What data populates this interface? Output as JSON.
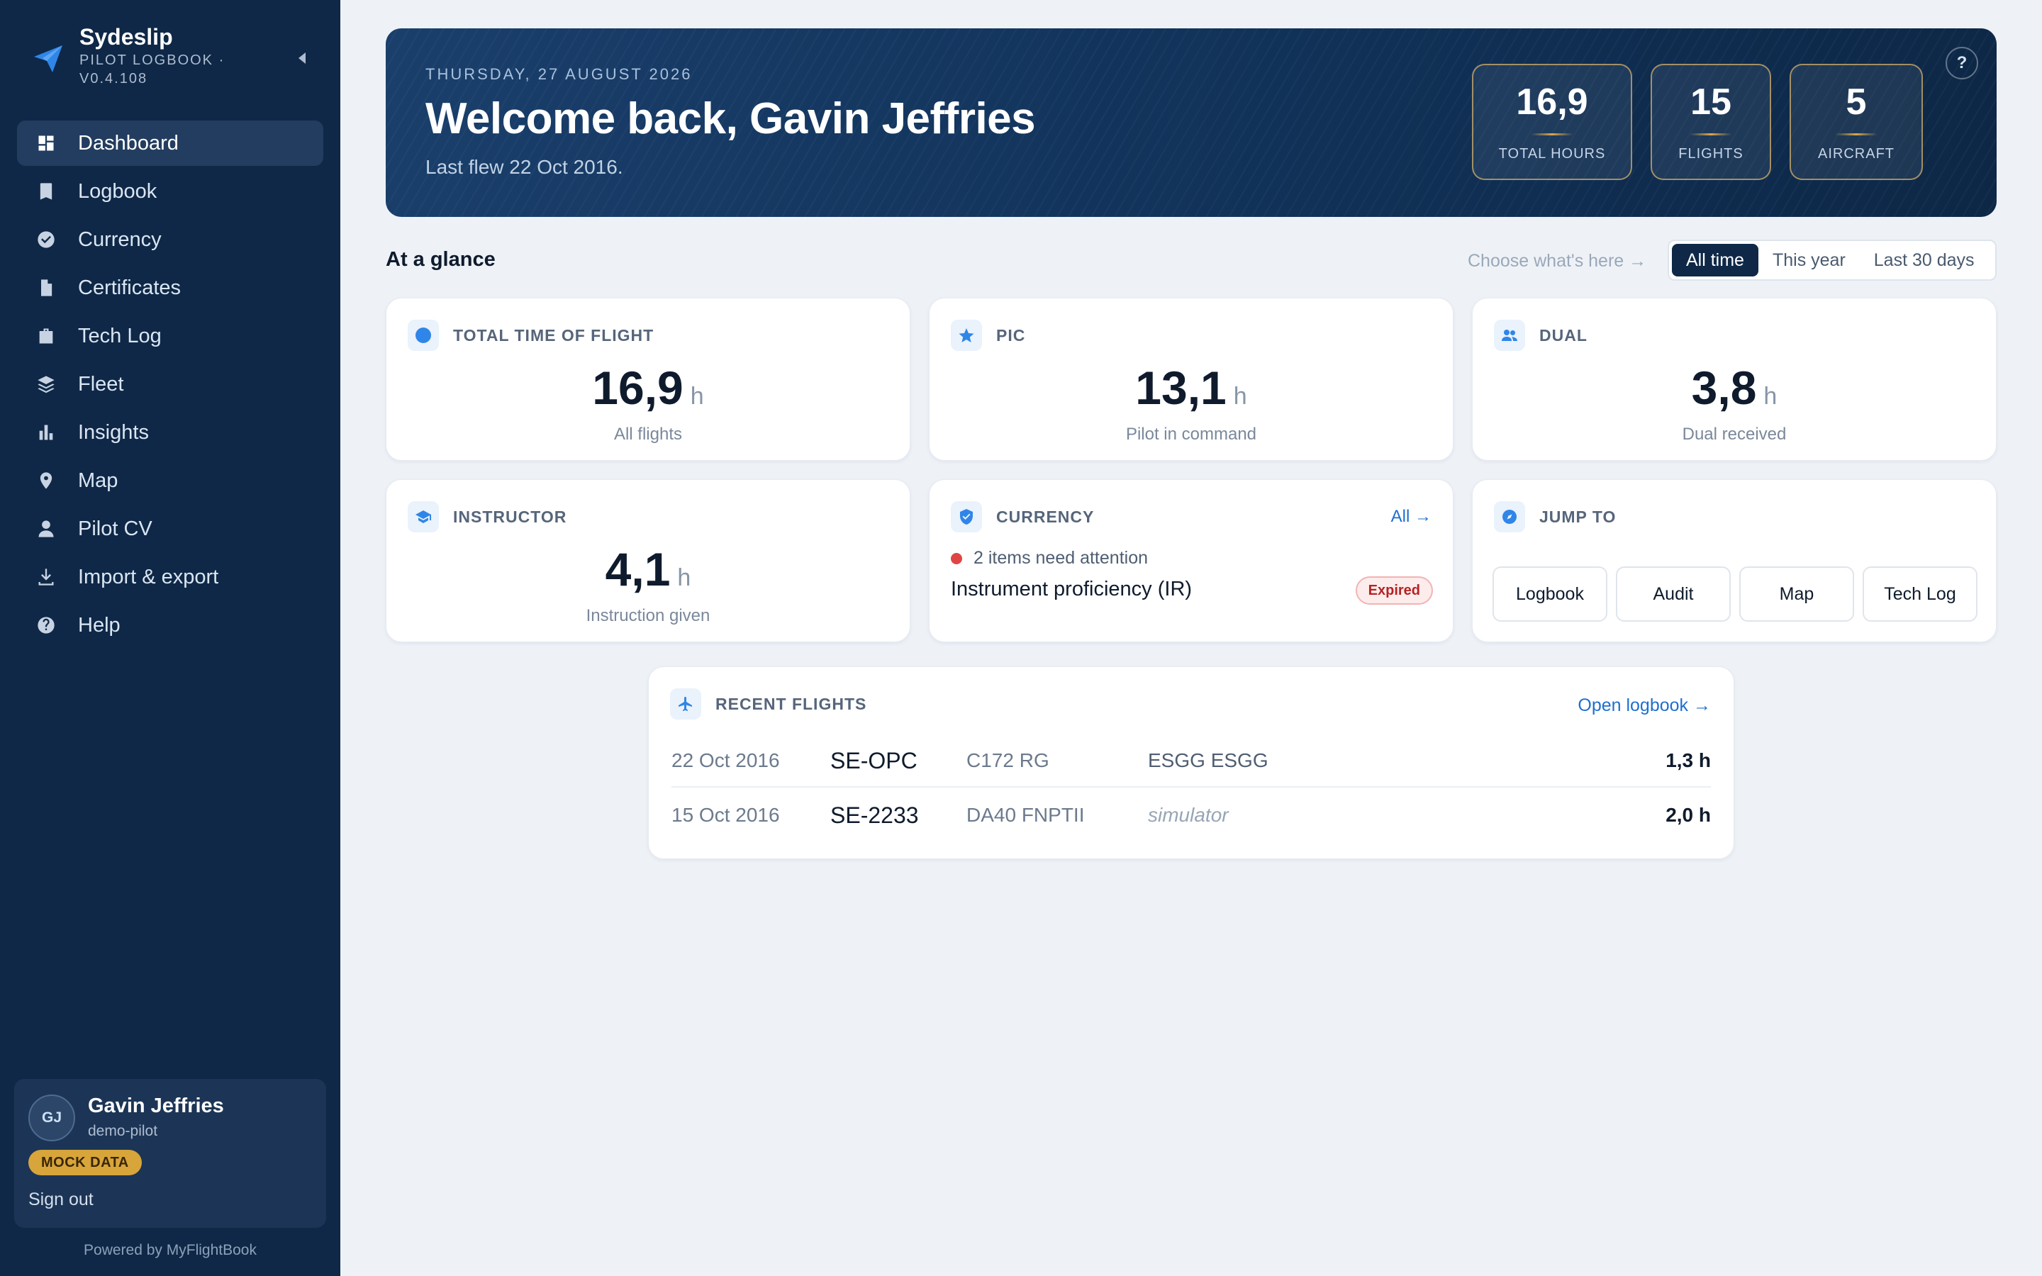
{
  "app": {
    "name": "Sydeslip",
    "subtitle": "PILOT LOGBOOK · V0.4.108",
    "accent": "#2f86e8",
    "sidebar_bg": "#0f2847"
  },
  "nav": [
    {
      "label": "Dashboard",
      "icon": "dashboard-icon",
      "active": true
    },
    {
      "label": "Logbook",
      "icon": "book-icon"
    },
    {
      "label": "Currency",
      "icon": "check-circle-icon"
    },
    {
      "label": "Certificates",
      "icon": "document-icon"
    },
    {
      "label": "Tech Log",
      "icon": "briefcase-icon"
    },
    {
      "label": "Fleet",
      "icon": "layers-icon"
    },
    {
      "label": "Insights",
      "icon": "bar-chart-icon"
    },
    {
      "label": "Map",
      "icon": "map-pin-icon"
    },
    {
      "label": "Pilot CV",
      "icon": "person-icon"
    },
    {
      "label": "Import & export",
      "icon": "download-icon"
    },
    {
      "label": "Help",
      "icon": "help-circle-icon"
    }
  ],
  "user": {
    "initials": "GJ",
    "name": "Gavin Jeffries",
    "handle": "demo-pilot",
    "badge": "MOCK DATA",
    "sign_out": "Sign out"
  },
  "footer": {
    "powered": "Powered by MyFlightBook"
  },
  "hero": {
    "date": "THURSDAY, 27 AUGUST 2026",
    "title": "Welcome back, Gavin Jeffries",
    "subtitle": "Last flew 22 Oct 2016.",
    "help": "?",
    "stats": [
      {
        "value": "16,9",
        "label": "TOTAL HOURS"
      },
      {
        "value": "15",
        "label": "FLIGHTS"
      },
      {
        "value": "5",
        "label": "AIRCRAFT"
      }
    ]
  },
  "glance": {
    "title": "At a glance",
    "choose": "Choose what's here →",
    "ranges": [
      "All time",
      "This year",
      "Last 30 days"
    ],
    "active_range": "All time"
  },
  "cards": {
    "total": {
      "label": "TOTAL TIME OF FLIGHT",
      "value": "16,9",
      "unit": "h",
      "caption": "All flights"
    },
    "pic": {
      "label": "PIC",
      "value": "13,1",
      "unit": "h",
      "caption": "Pilot in command"
    },
    "dual": {
      "label": "DUAL",
      "value": "3,8",
      "unit": "h",
      "caption": "Dual received"
    },
    "instructor": {
      "label": "INSTRUCTOR",
      "value": "4,1",
      "unit": "h",
      "caption": "Instruction given"
    },
    "currency": {
      "label": "CURRENCY",
      "link": "All →",
      "alert": "2 items need attention",
      "item": "Instrument proficiency (IR)",
      "status": "Expired"
    },
    "jump": {
      "label": "JUMP TO",
      "buttons": [
        "Logbook",
        "Audit",
        "Map",
        "Tech Log"
      ]
    }
  },
  "recent": {
    "label": "RECENT FLIGHTS",
    "link": "Open logbook →",
    "flights": [
      {
        "date": "22 Oct 2016",
        "reg": "SE-OPC",
        "type": "C172 RG",
        "route": "ESGG ESGG",
        "duration": "1,3 h"
      },
      {
        "date": "15 Oct 2016",
        "reg": "SE-2233",
        "type": "DA40 FNPTII",
        "route": "simulator",
        "duration": "2,0 h"
      }
    ]
  }
}
